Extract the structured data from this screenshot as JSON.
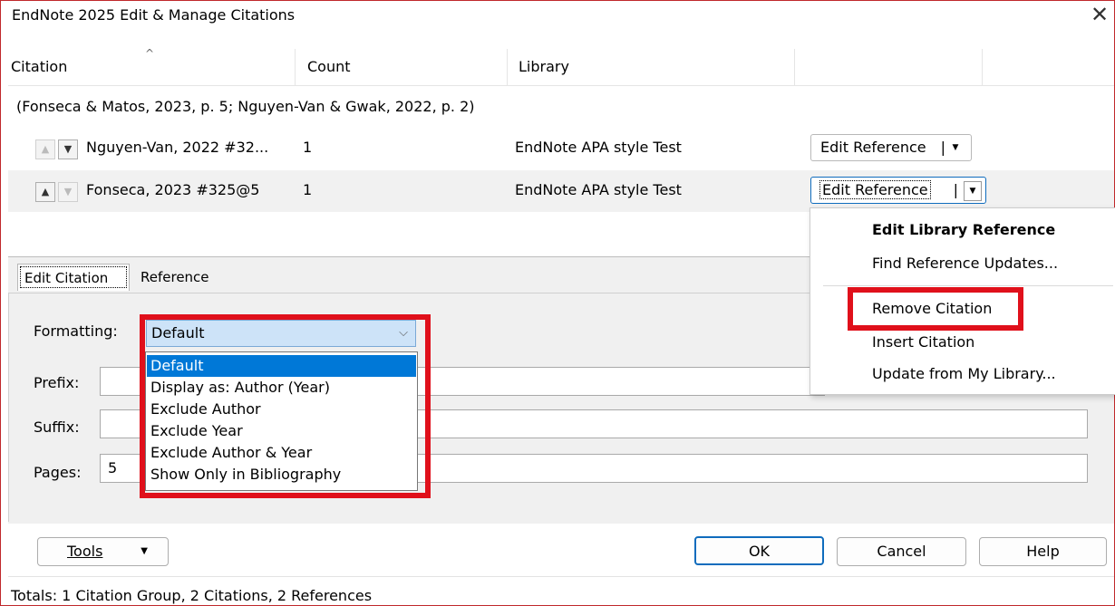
{
  "window": {
    "title": "EndNote 2025 Edit & Manage Citations",
    "close_label": "✕"
  },
  "columns": {
    "citation": "Citation",
    "count": "Count",
    "library": "Library"
  },
  "citation_group": "(Fonseca & Matos, 2023, p. 5; Nguyen-Van & Gwak, 2022, p. 2)",
  "rows": [
    {
      "citation": "Nguyen-Van, 2022 #32...",
      "count": "1",
      "library": "EndNote APA style Test",
      "action": "Edit Reference"
    },
    {
      "citation": "Fonseca, 2023 #325@5",
      "count": "1",
      "library": "EndNote APA style Test",
      "action": "Edit Reference"
    }
  ],
  "tabs": {
    "edit_citation": "Edit Citation",
    "reference": "Reference"
  },
  "form": {
    "formatting_label": "Formatting:",
    "formatting_value": "Default",
    "prefix_label": "Prefix:",
    "suffix_label": "Suffix:",
    "pages_label": "Pages:",
    "pages_value": "5"
  },
  "formatting_options": [
    "Default",
    "Display as: Author (Year)",
    "Exclude Author",
    "Exclude Year",
    "Exclude Author & Year",
    "Show Only in Bibliography"
  ],
  "context_menu": {
    "edit_library_reference": "Edit Library Reference",
    "find_reference_updates": "Find Reference Updates...",
    "remove_citation": "Remove Citation",
    "insert_citation": "Insert Citation",
    "update_from_library": "Update from My Library..."
  },
  "buttons": {
    "tools": "Tools",
    "ok": "OK",
    "cancel": "Cancel",
    "help": "Help"
  },
  "status": "Totals: 1 Citation Group, 2 Citations, 2 References",
  "colors": {
    "highlight_box": "#e0101b",
    "selection": "#0078d7",
    "focus": "#0f6cbd"
  }
}
